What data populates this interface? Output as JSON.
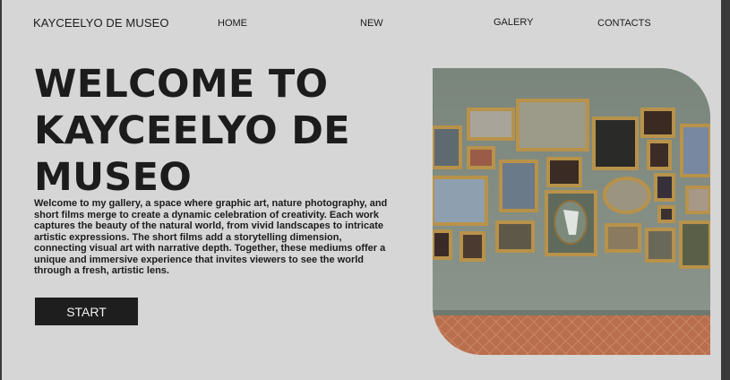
{
  "header": {
    "brand": "KAYCEELYO DE MUSEO",
    "nav": [
      "HOME",
      "NEW",
      "GALERY",
      "CONTACTS"
    ]
  },
  "hero": {
    "title_lines": [
      "WELCOME TO",
      "KAYCEELYO DE",
      "MUSEO"
    ],
    "description": "Welcome to my gallery, a space where graphic art, nature photography, and short films merge to create a dynamic celebration of creativity. Each work captures the beauty of the natural world, from vivid landscapes to intricate artistic expressions. The short films add a storytelling dimension, connecting visual art with narrative depth. Together, these mediums offer a unique and immersive experience that invites viewers to see the world through a fresh, artistic lens.",
    "cta_label": "START"
  },
  "colors": {
    "background": "#d6d6d6",
    "text": "#1c1c1c",
    "button": "#1e1e1e",
    "wall": "#7f8a80",
    "frame_gold": "#b8924a",
    "floor": "#b86f4e"
  }
}
